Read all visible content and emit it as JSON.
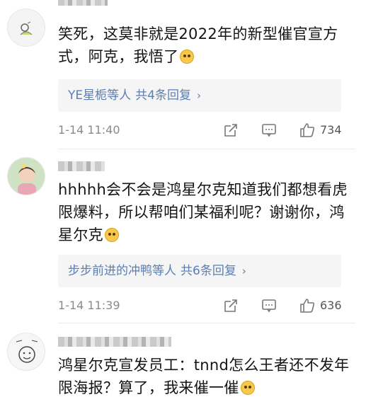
{
  "comments": [
    {
      "text": "笑死，这莫非就是2022年的新型催官宣方式，阿克，我悟了",
      "emoji": "grinning-sweat-emoji",
      "replies_names": "YE星栀等人",
      "replies_count": "共4条回复",
      "timestamp": "1-14 11:40",
      "likes": "734"
    },
    {
      "text": "hhhhh会不会是鸿星尔克知道我们都想看虎限爆料，所以帮咱们某福利呢？谢谢你，鸿星尔克",
      "emoji": "crying-face-emoji",
      "replies_names": "步步前进的冲鸭等人",
      "replies_count": "共6条回复",
      "timestamp": "1-14 11:39",
      "likes": "636"
    },
    {
      "text": "鸿星尔克宣发员工：tnnd怎么王者还不发年限海报？算了，我来催一催",
      "emoji": "doge-emoji"
    }
  ],
  "colors": {
    "link_blue": "#5a7fb5",
    "meta_gray": "#8a8a8a",
    "reply_bg": "#f5f5f5"
  },
  "icons": [
    "share-icon",
    "comment-icon",
    "like-icon",
    "chevron-right-icon"
  ]
}
